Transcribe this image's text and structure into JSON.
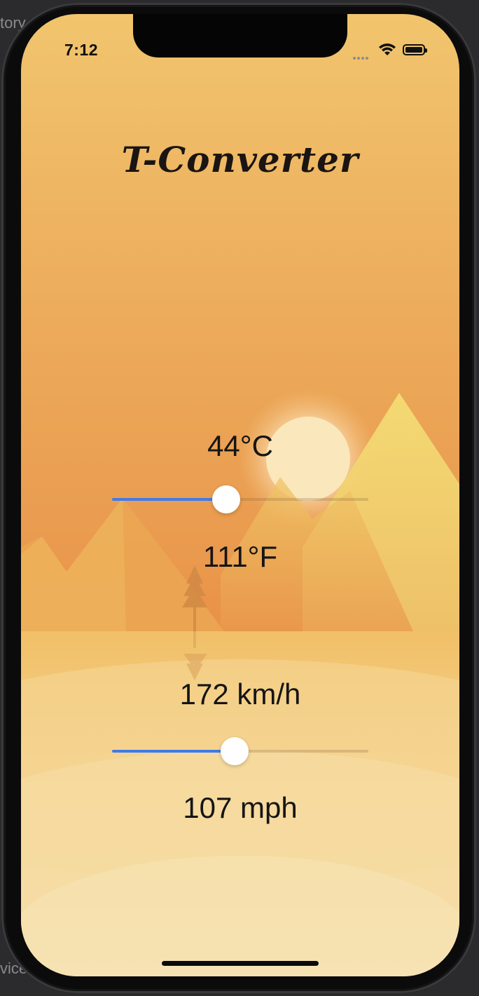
{
  "window": {
    "ghost_top_text": "tory",
    "ghost_bottom_text": "vice"
  },
  "status_bar": {
    "time": "7:12",
    "icons": [
      "signal-icon",
      "wifi-icon",
      "battery-icon"
    ]
  },
  "app": {
    "title": "T-Converter"
  },
  "temperature": {
    "celsius_label": "44°C",
    "fahrenheit_label": "111°F",
    "slider_fraction": 0.445
  },
  "speed": {
    "kmh_label": "172 km/h",
    "mph_label": "107 mph",
    "slider_fraction": 0.478
  },
  "colors": {
    "accent": "#3f7bea",
    "sky_top": "#f1c56d",
    "sky_bottom": "#e99248",
    "sun": "#fbe7bc",
    "mountain": "#f3d76f",
    "desert": "#f5d999"
  }
}
